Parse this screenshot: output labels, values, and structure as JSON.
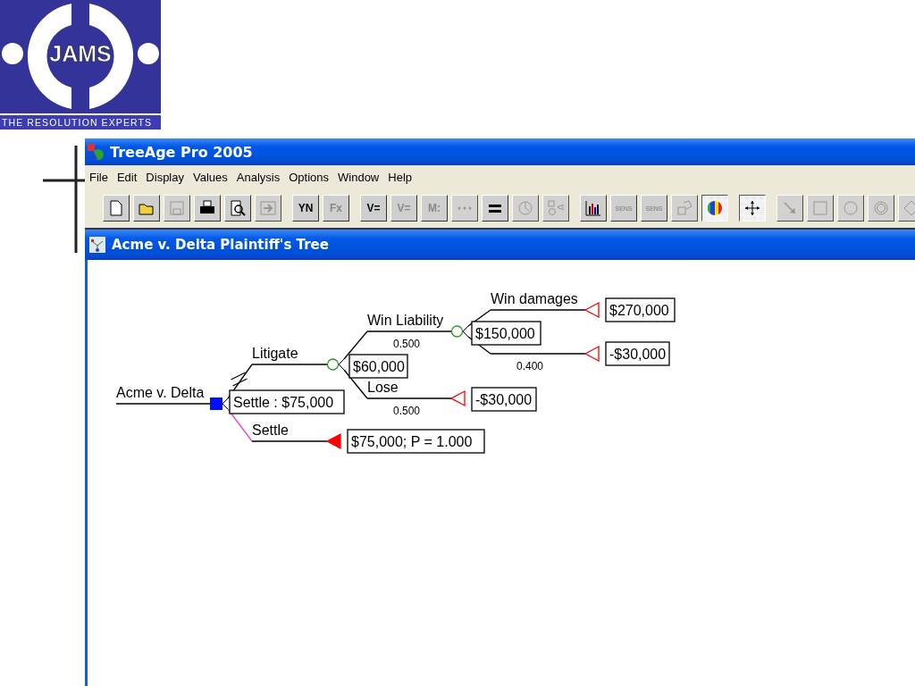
{
  "logo": {
    "name": "JAMS",
    "tagline": "THE RESOLUTION EXPERTS"
  },
  "window": {
    "title": "TreeAge Pro 2005"
  },
  "menu": [
    "File",
    "Edit",
    "Display",
    "Values",
    "Analysis",
    "Options",
    "Window",
    "Help"
  ],
  "toolbar": [
    [
      {
        "kind": "new",
        "disabled": false,
        "pressed": false
      },
      {
        "kind": "open",
        "disabled": false,
        "pressed": false
      },
      {
        "kind": "save",
        "disabled": true,
        "pressed": false
      },
      {
        "kind": "print",
        "disabled": false,
        "pressed": false
      },
      {
        "kind": "preview",
        "disabled": false,
        "pressed": false
      },
      {
        "kind": "export",
        "disabled": true,
        "pressed": false
      }
    ],
    [
      {
        "kind": "text",
        "label": "YN",
        "disabled": false,
        "pressed": false
      },
      {
        "kind": "text",
        "label": "Fx",
        "disabled": true,
        "pressed": false
      }
    ],
    [
      {
        "kind": "text",
        "label": "V=",
        "disabled": false,
        "pressed": false
      },
      {
        "kind": "text",
        "label": "V=",
        "disabled": true,
        "pressed": false
      },
      {
        "kind": "text",
        "label": "M:",
        "disabled": true,
        "pressed": false
      },
      {
        "kind": "dots",
        "disabled": true,
        "pressed": false
      },
      {
        "kind": "equals",
        "disabled": false,
        "pressed": false
      },
      {
        "kind": "clock",
        "disabled": true,
        "pressed": false
      },
      {
        "kind": "shapes",
        "disabled": true,
        "pressed": false
      }
    ],
    [
      {
        "kind": "chart",
        "disabled": false,
        "pressed": false
      },
      {
        "kind": "sens",
        "label": "SENS",
        "disabled": true,
        "pressed": false
      },
      {
        "kind": "sens",
        "label": "SENS",
        "disabled": true,
        "pressed": false
      },
      {
        "kind": "dice",
        "disabled": true,
        "pressed": false
      },
      {
        "kind": "color",
        "disabled": false,
        "pressed": true
      }
    ],
    [
      {
        "kind": "move",
        "disabled": false,
        "pressed": true
      }
    ],
    [
      {
        "kind": "arrow",
        "disabled": true,
        "pressed": false
      },
      {
        "kind": "square",
        "disabled": true,
        "pressed": false
      },
      {
        "kind": "circle",
        "disabled": true,
        "pressed": false
      },
      {
        "kind": "ring",
        "disabled": true,
        "pressed": false
      },
      {
        "kind": "diamond",
        "disabled": true,
        "pressed": false
      }
    ]
  ],
  "document": {
    "title": "Acme v. Delta Plaintiff's Tree"
  },
  "tree": {
    "name": "Acme v. Delta",
    "kind": "decision",
    "value": "Settle : $75,000",
    "children": [
      {
        "name": "Litigate",
        "kind": "chance",
        "value": "$60,000",
        "pruned": true,
        "optimal": false,
        "children": [
          {
            "name": "Win Liability",
            "probability": "0.500",
            "kind": "chance",
            "value": "$150,000",
            "pruned": false,
            "optimal": false,
            "children": [
              {
                "name": "Win damages",
                "kind": "terminal",
                "value": "$270,000",
                "pruned": false,
                "optimal": false
              },
              {
                "probability": "0.400",
                "kind": "terminal",
                "value": "-$30,000",
                "pruned": false,
                "optimal": false
              }
            ]
          },
          {
            "name": "Lose",
            "probability": "0.500",
            "kind": "terminal",
            "value": "-$30,000",
            "pruned": false,
            "optimal": false
          }
        ]
      },
      {
        "name": "Settle",
        "kind": "terminal",
        "value": "$75,000; P = 1.000",
        "pruned": false,
        "optimal": true
      }
    ]
  }
}
